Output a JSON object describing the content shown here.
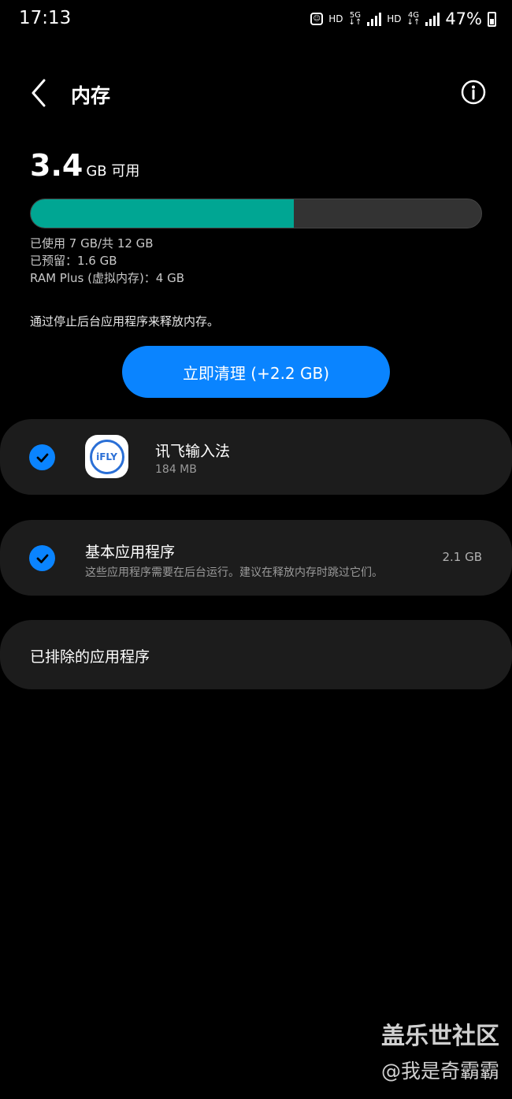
{
  "status_bar": {
    "time": "17:13",
    "hd1": "HD",
    "net_5g": "5G",
    "hd2": "HD",
    "net_4g": "4G",
    "battery": "47%"
  },
  "header": {
    "title": "内存",
    "back_icon": "chevron-left-icon",
    "info_icon": "info-icon"
  },
  "memory": {
    "available_value": "3.4",
    "available_unit": "GB 可用",
    "used_fraction": 0.5833,
    "used_text": "已使用 7 GB/共 12 GB",
    "reserved_text": "已预留：1.6 GB",
    "ram_plus_text": "RAM Plus (虚拟内存)：4 GB",
    "hint": "通过停止后台应用程序来释放内存。",
    "clean_button": "立即清理 (+2.2 GB)"
  },
  "apps": [
    {
      "name": "讯飞输入法",
      "size": "184 MB",
      "checked": true,
      "icon_text": "iFLY"
    }
  ],
  "system_apps": {
    "name": "基本应用程序",
    "description": "这些应用程序需要在后台运行。建议在释放内存时跳过它们。",
    "size": "2.1 GB",
    "checked": true
  },
  "excluded": {
    "label": "已排除的应用程序"
  },
  "watermark": {
    "line1": "盖乐世社区",
    "line2": "@我是奇霸霸"
  },
  "colors": {
    "accent": "#0a84ff",
    "bar_fill": "#00a693",
    "card": "#1c1c1c"
  }
}
